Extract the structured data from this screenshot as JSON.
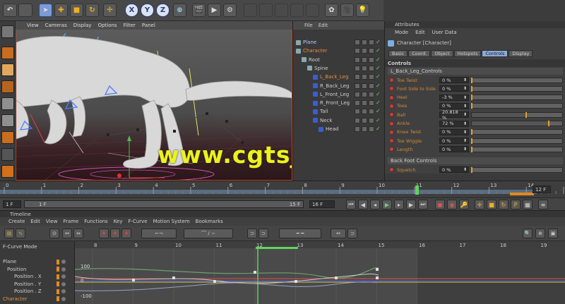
{
  "toolbar": {
    "icons": [
      "undo-icon",
      "select-arrow-icon",
      "move-icon",
      "scale-icon",
      "rotate-icon",
      "add-icon",
      "x-axis",
      "y-axis",
      "z-axis",
      "world-coords-icon",
      "render-view-icon",
      "render-picture-icon",
      "render-settings-icon",
      "cube-icon",
      "pen-icon",
      "subdivision-icon",
      "array-icon",
      "deformer-icon",
      "scene-icon",
      "camera-icon",
      "light-icon"
    ],
    "x_label": "X",
    "y_label": "Y",
    "z_label": "Z"
  },
  "viewport": {
    "menu": [
      "View",
      "Cameras",
      "Display",
      "Options",
      "Filter",
      "Panel"
    ]
  },
  "watermark": "www.cgtsj.com",
  "object_manager": {
    "menu": [
      "File",
      "Edit"
    ],
    "items": [
      {
        "name": "Plane",
        "depth": 0,
        "color": "#b8c8ff"
      },
      {
        "name": "Character",
        "depth": 0,
        "color": "#e8903a"
      },
      {
        "name": "Root",
        "depth": 1,
        "color": "#cfcfcf"
      },
      {
        "name": "Spine",
        "depth": 2,
        "color": "#cfcfcf"
      },
      {
        "name": "L_Back_Leg",
        "depth": 3,
        "color": "#e8903a"
      },
      {
        "name": "R_Back_Leg",
        "depth": 3,
        "color": "#cfcfcf"
      },
      {
        "name": "L_Front_Leg",
        "depth": 3,
        "color": "#cfcfcf"
      },
      {
        "name": "R_Front_Leg",
        "depth": 3,
        "color": "#cfcfcf"
      },
      {
        "name": "Tail",
        "depth": 3,
        "color": "#cfcfcf"
      },
      {
        "name": "Neck",
        "depth": 3,
        "color": "#cfcfcf"
      },
      {
        "name": "Head",
        "depth": 4,
        "color": "#cfcfcf"
      }
    ]
  },
  "attributes": {
    "title": "Attributes",
    "menu": [
      "Mode",
      "Edit",
      "User Data"
    ],
    "object_name": "Character [Character]",
    "tabs": [
      "Basic",
      "Coord.",
      "Object",
      "Hotspots",
      "Controls",
      "Display"
    ],
    "active_tab": "Controls",
    "section": "Controls",
    "group": "L_Back_Leg_Controls",
    "params": [
      {
        "label": "Toe Twist",
        "value": "0 %",
        "fill": 0.0
      },
      {
        "label": "Foot Side to Side",
        "value": "0 %",
        "fill": 0.0
      },
      {
        "label": "Heel",
        "value": "-3 %",
        "fill": 0.0
      },
      {
        "label": "Toes",
        "value": "0 %",
        "fill": 0.0
      },
      {
        "label": "Ball",
        "value": "20.818 %",
        "fill": 0.6
      },
      {
        "label": "Ankle",
        "value": "72 %",
        "fill": 0.85
      },
      {
        "label": "Knee Twist",
        "value": "0 %",
        "fill": 0.0
      },
      {
        "label": "Toe Wiggle",
        "value": "0 %",
        "fill": 0.0
      },
      {
        "label": "Length",
        "value": "0 %",
        "fill": 0.0
      }
    ],
    "group2": "Back Foot Controls",
    "params2": [
      {
        "label": "Squetch",
        "value": "0 %",
        "fill": 0.0
      }
    ]
  },
  "ruler": {
    "ticks": [
      "0",
      "1",
      "2",
      "3",
      "4",
      "5",
      "6",
      "7",
      "8",
      "9",
      "10",
      "11",
      "12",
      "13",
      "14",
      "15"
    ],
    "frame_label": "12 F",
    "current_frame": 12
  },
  "transport": {
    "start": "1 F",
    "range_start": "1 F",
    "range_end": "15 F",
    "end": "16 F"
  },
  "timeline": {
    "title": "Timeline",
    "menu": [
      "Create",
      "Edit",
      "View",
      "Frame",
      "Functions",
      "Key",
      "F-Curve",
      "Motion System",
      "Bookmarks"
    ],
    "mode": "F-Curve Mode",
    "ticks": [
      "8",
      "9",
      "10",
      "11",
      "12",
      "13",
      "14",
      "15",
      "16",
      "17",
      "18",
      "19"
    ],
    "tracks": [
      "Plane",
      "Position",
      "Position . X",
      "Position . Y",
      "Position . Z",
      "Character"
    ],
    "y_labels": [
      "100",
      "0",
      "-100"
    ]
  }
}
